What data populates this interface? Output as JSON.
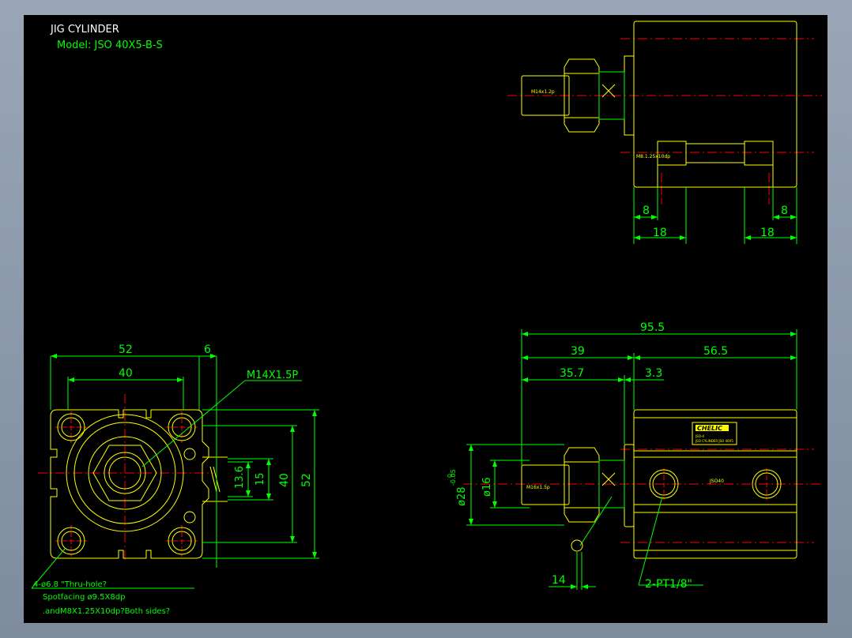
{
  "title": {
    "name": "JIG CYLINDER",
    "model": "Model:  JSO 40X5-B-S"
  },
  "colors": {
    "outline": "#ffff00",
    "dimension": "#00ff00",
    "centerline": "#ff0000",
    "background": "#000000"
  },
  "front_view": {
    "dims": {
      "width_overall": "52",
      "width_extra": "6",
      "hole_pitch": "40",
      "rod_thread": "M14X1.5P",
      "d1": "13.6",
      "d2": "15",
      "height_pitch": "40",
      "height_overall": "52"
    },
    "notes": [
      "4-ø6.8 \"Thru-hole?",
      "Spotfacing  ø9.5X8dp",
      ".andM8X1.25X10dp?Both sides?"
    ]
  },
  "top_view": {
    "rod_label": "M14x1.2p",
    "tap_label": "M8.1.25x10dp",
    "dims": {
      "left_small": "8",
      "right_small": "8",
      "left_large": "18",
      "right_large": "18"
    }
  },
  "side_view": {
    "rod_label": "M16x1.5p",
    "model_small": "JSO40",
    "brand": "CHELIC",
    "plate_lines": [
      "JSO-4",
      "JSO CYLINDER  JSO 40X5"
    ],
    "dims": {
      "total": "95.5",
      "left": "39",
      "right": "56.5",
      "rod_len": "35.7",
      "flange": "3.3",
      "bore": "ø28",
      "bore_tol_upper": "0",
      "bore_tol_lower": "-0.05",
      "rod_dia": "ø16",
      "nut_len": "14",
      "port": "2-PT1/8\""
    }
  }
}
